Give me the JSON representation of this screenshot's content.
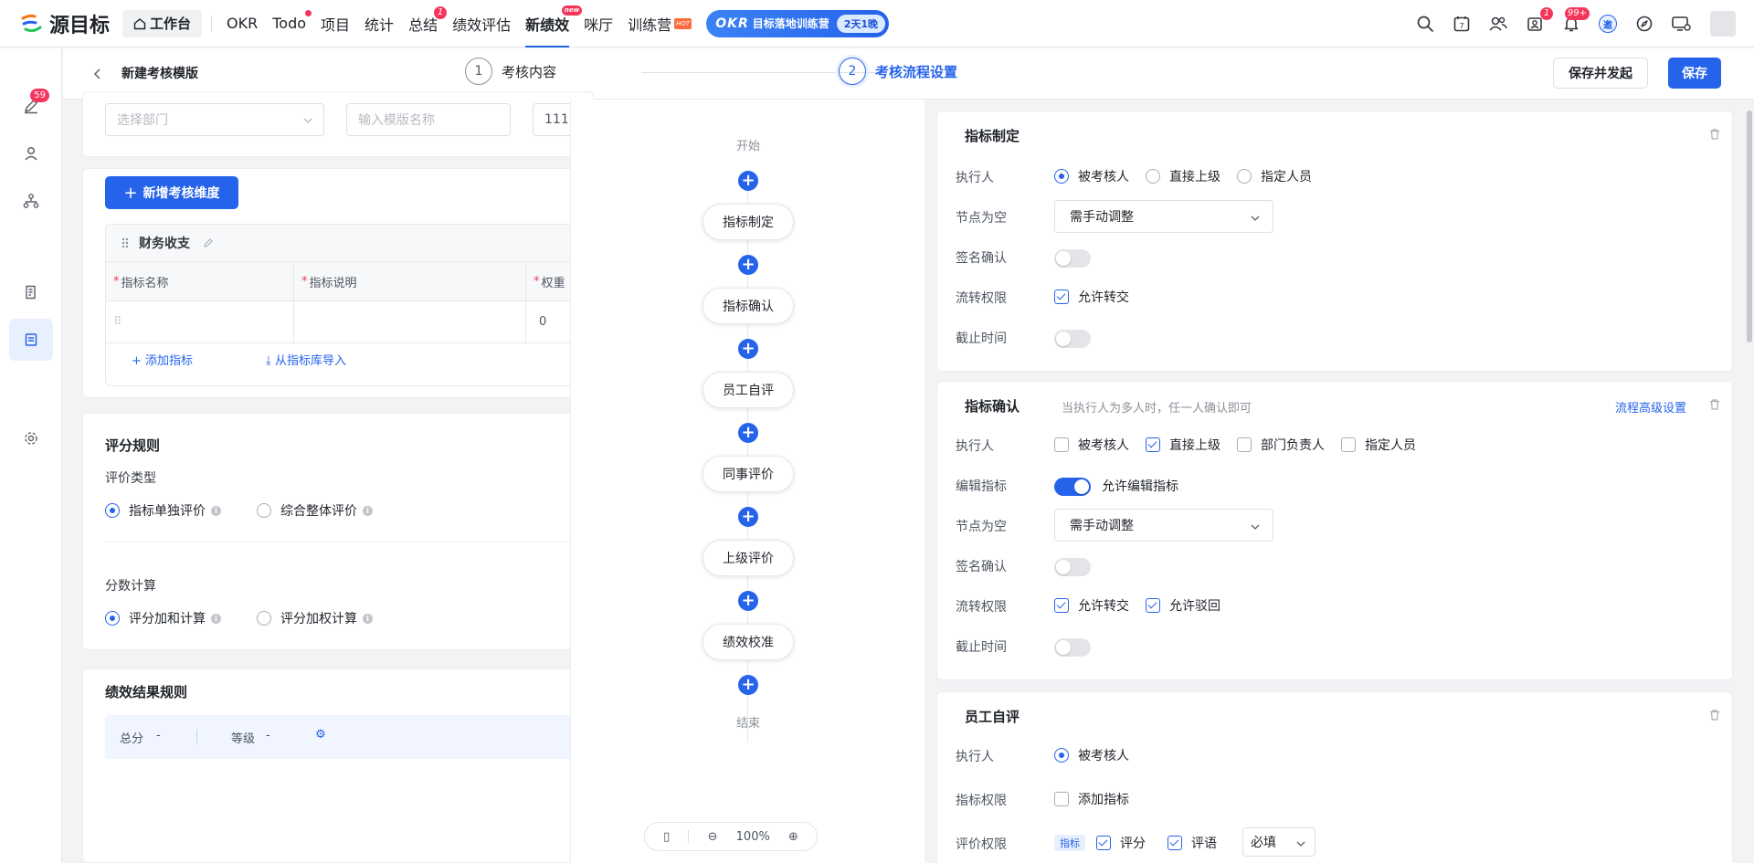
{
  "app": {
    "logo_text": "源目标",
    "home_label": "工作台"
  },
  "nav": {
    "items": [
      {
        "label": "OKR"
      },
      {
        "label": "Todo"
      },
      {
        "label": "项目"
      },
      {
        "label": "统计"
      },
      {
        "label": "总结",
        "badge": "1"
      },
      {
        "label": "绩效评估"
      },
      {
        "label": "新绩效",
        "tag": "new"
      },
      {
        "label": "咪厅"
      },
      {
        "label": "训练营",
        "tag": "HOT"
      }
    ],
    "promo": {
      "okr": "OKR",
      "text": "目标落地训练营",
      "days": "2天1晚"
    }
  },
  "topright": {
    "messages_badge": "1",
    "bell_badge": "99+",
    "invite_label": "邀"
  },
  "rail": {
    "edit_badge": "59"
  },
  "header": {
    "title": "新建考核模版",
    "step1_num": "1",
    "step1_label": "考核内容",
    "step2_num": "2",
    "step2_label": "考核流程设置",
    "save_launch": "保存并发起",
    "save": "保存"
  },
  "form": {
    "dept_placeholder": "选择部门",
    "name_placeholder": "输入模版名称",
    "third_value": "111"
  },
  "dimension": {
    "add_button": "新增考核维度",
    "name": "财务收支",
    "columns": [
      "指标名称",
      "指标说明",
      "权重"
    ],
    "row_weight": "0",
    "add_indicator": "添加指标",
    "import_indicator": "从指标库导入"
  },
  "scoring": {
    "title": "评分规则",
    "eval_type_label": "评价类型",
    "eval_opt1": "指标单独评价",
    "eval_opt2": "综合整体评价",
    "calc_label": "分数计算",
    "calc_opt1": "评分加和计算",
    "calc_opt2": "评分加权计算"
  },
  "result": {
    "title": "绩效结果规则",
    "total_label": "总分",
    "total_value": "-",
    "level_label": "等级",
    "level_value": "-"
  },
  "flow": {
    "start": "开始",
    "end": "结束",
    "nodes": [
      "指标制定",
      "指标确认",
      "员工自评",
      "同事评价",
      "上级评价",
      "绩效校准"
    ],
    "zoom": "100%"
  },
  "node1": {
    "title": "指标制定",
    "executor_label": "执行人",
    "executor_opts": [
      "被考核人",
      "直接上级",
      "指定人员"
    ],
    "empty_label": "节点为空",
    "empty_value": "需手动调整",
    "sign_label": "签名确认",
    "transfer_label": "流转权限",
    "transfer_opt": "允许转交",
    "deadline_label": "截止时间"
  },
  "node2": {
    "title": "指标确认",
    "hint": "当执行人为多人时，任一人确认即可",
    "advanced": "流程高级设置",
    "executor_label": "执行人",
    "executor_opts": [
      "被考核人",
      "直接上级",
      "部门负责人",
      "指定人员"
    ],
    "edit_label": "编辑指标",
    "edit_opt": "允许编辑指标",
    "empty_label": "节点为空",
    "empty_value": "需手动调整",
    "sign_label": "签名确认",
    "transfer_label": "流转权限",
    "transfer_opt1": "允许转交",
    "transfer_opt2": "允许驳回",
    "deadline_label": "截止时间"
  },
  "node3": {
    "title": "员工自评",
    "executor_label": "执行人",
    "executor_opt": "被考核人",
    "perm_label": "指标权限",
    "perm_opt": "添加指标",
    "eval_label": "评价权限",
    "eval_tag": "指标",
    "eval_opt1": "评分",
    "eval_opt2": "评语",
    "eval_required": "必填"
  }
}
